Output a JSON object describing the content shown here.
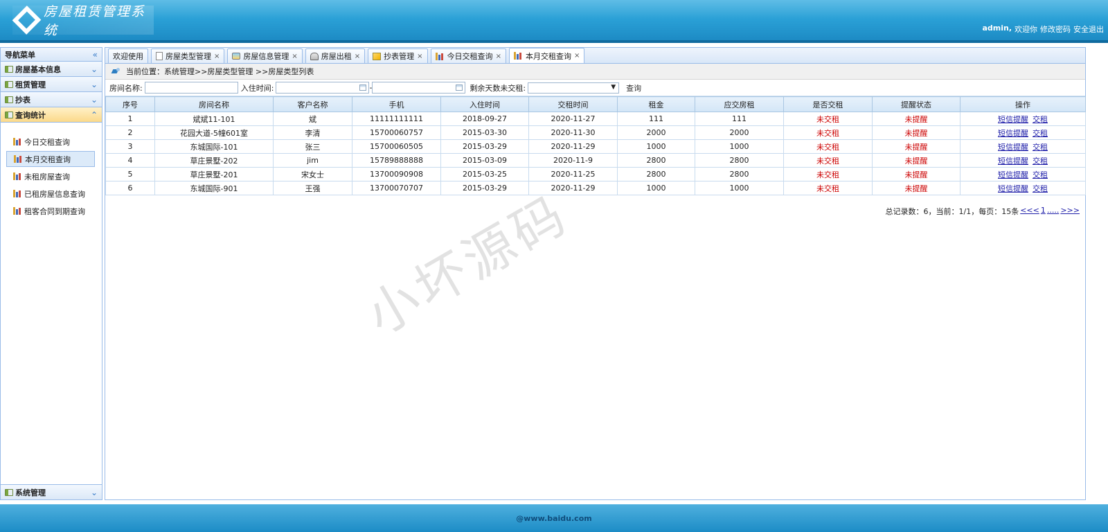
{
  "header": {
    "app_title": "房屋租赁管理系统",
    "username": "admin,",
    "welcome": "欢迎你",
    "change_password": "修改密码",
    "logout": "安全退出"
  },
  "sidebar": {
    "title": "导航菜单",
    "sections": [
      {
        "label": "房屋基本信息"
      },
      {
        "label": "租赁管理"
      },
      {
        "label": "抄表"
      },
      {
        "label": "查询统计"
      }
    ],
    "sub_items": [
      {
        "label": "今日交租查询"
      },
      {
        "label": "本月交租查询"
      },
      {
        "label": "未租房屋查询"
      },
      {
        "label": "已租房屋信息查询"
      },
      {
        "label": "租客合同到期查询"
      }
    ],
    "bottom_section": "系统管理"
  },
  "tabs": [
    {
      "label": "欢迎使用"
    },
    {
      "label": "房屋类型管理"
    },
    {
      "label": "房屋信息管理"
    },
    {
      "label": "房屋出租"
    },
    {
      "label": "抄表管理"
    },
    {
      "label": "今日交租查询"
    },
    {
      "label": "本月交租查询"
    }
  ],
  "breadcrumb": "当前位置：系统管理>>房屋类型管理 >>房屋类型列表",
  "search": {
    "room_label": "房间名称:",
    "checkin_label": "入住时间:",
    "dash": "-",
    "days_label": "剩余天数未交租:",
    "query_label": "查询",
    "room_value": "",
    "date_from": "",
    "date_to": ""
  },
  "table": {
    "headers": [
      "序号",
      "房间名称",
      "客户名称",
      "手机",
      "入住时间",
      "交租时间",
      "租金",
      "应交房租",
      "是否交租",
      "提醒状态",
      "操作"
    ],
    "rows": [
      [
        "1",
        "斌斌11-101",
        "斌",
        "11111111111",
        "2018-09-27",
        "2020-11-27",
        "111",
        "111",
        "未交租",
        "未提醒"
      ],
      [
        "2",
        "花园大道-5幢601室",
        "李清",
        "15700060757",
        "2015-03-30",
        "2020-11-30",
        "2000",
        "2000",
        "未交租",
        "未提醒"
      ],
      [
        "3",
        "东城国际-101",
        "张三",
        "15700060505",
        "2015-03-29",
        "2020-11-29",
        "1000",
        "1000",
        "未交租",
        "未提醒"
      ],
      [
        "4",
        "草庄景墅-202",
        "jim",
        "15789888888",
        "2015-03-09",
        "2020-11-9",
        "2800",
        "2800",
        "未交租",
        "未提醒"
      ],
      [
        "5",
        "草庄景墅-201",
        "宋女士",
        "13700090908",
        "2015-03-25",
        "2020-11-25",
        "2800",
        "2800",
        "未交租",
        "未提醒"
      ],
      [
        "6",
        "东城国际-901",
        "王强",
        "13700070707",
        "2015-03-29",
        "2020-11-29",
        "1000",
        "1000",
        "未交租",
        "未提醒"
      ]
    ],
    "action_sms": "短信提醒",
    "action_pay": "交租"
  },
  "pager": {
    "summary": "总记录数：6，当前：1/1，每页：15条",
    "prev": "<<<",
    "page": "1",
    "dots": ".....",
    "next": ">>>"
  },
  "watermark": "小坏源码",
  "footer": "@www.baidu.com",
  "colors": {
    "accent": "#1b88c2",
    "status_red": "#cc0000",
    "link": "#1c1ca8"
  }
}
